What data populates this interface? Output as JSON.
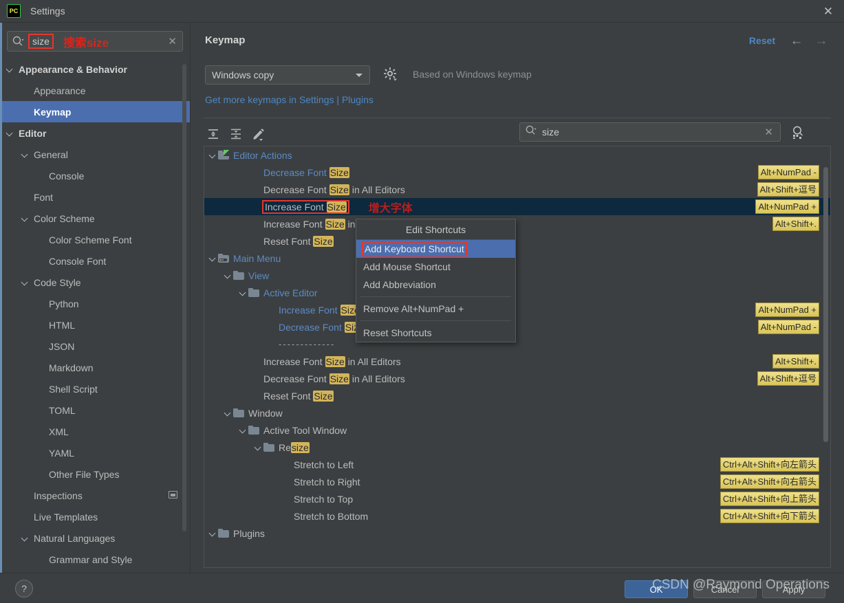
{
  "window": {
    "title": "Settings",
    "app_icon": "pycharm-icon",
    "close_icon": "close-icon"
  },
  "sidebar": {
    "search": {
      "value": "size",
      "annotation": "搜索size",
      "clear_icon": "clear-icon",
      "search_icon": "search-icon"
    },
    "items": [
      {
        "label": "Appearance & Behavior",
        "indent": 0,
        "chevron": true,
        "bold": true,
        "selected": false
      },
      {
        "label": "Appearance",
        "indent": 1,
        "chevron": false,
        "bold": false,
        "selected": false
      },
      {
        "label": "Keymap",
        "indent": 1,
        "chevron": false,
        "bold": true,
        "selected": true
      },
      {
        "label": "Editor",
        "indent": 0,
        "chevron": true,
        "bold": true,
        "selected": false
      },
      {
        "label": "General",
        "indent": 1,
        "chevron": true,
        "bold": false,
        "selected": false
      },
      {
        "label": "Console",
        "indent": 2,
        "chevron": false,
        "bold": false,
        "selected": false
      },
      {
        "label": "Font",
        "indent": 1,
        "chevron": false,
        "bold": false,
        "selected": false
      },
      {
        "label": "Color Scheme",
        "indent": 1,
        "chevron": true,
        "bold": false,
        "selected": false
      },
      {
        "label": "Color Scheme Font",
        "indent": 2,
        "chevron": false,
        "bold": false,
        "selected": false
      },
      {
        "label": "Console Font",
        "indent": 2,
        "chevron": false,
        "bold": false,
        "selected": false
      },
      {
        "label": "Code Style",
        "indent": 1,
        "chevron": true,
        "bold": false,
        "selected": false
      },
      {
        "label": "Python",
        "indent": 2,
        "chevron": false,
        "bold": false,
        "selected": false
      },
      {
        "label": "HTML",
        "indent": 2,
        "chevron": false,
        "bold": false,
        "selected": false
      },
      {
        "label": "JSON",
        "indent": 2,
        "chevron": false,
        "bold": false,
        "selected": false
      },
      {
        "label": "Markdown",
        "indent": 2,
        "chevron": false,
        "bold": false,
        "selected": false
      },
      {
        "label": "Shell Script",
        "indent": 2,
        "chevron": false,
        "bold": false,
        "selected": false
      },
      {
        "label": "TOML",
        "indent": 2,
        "chevron": false,
        "bold": false,
        "selected": false
      },
      {
        "label": "XML",
        "indent": 2,
        "chevron": false,
        "bold": false,
        "selected": false
      },
      {
        "label": "YAML",
        "indent": 2,
        "chevron": false,
        "bold": false,
        "selected": false
      },
      {
        "label": "Other File Types",
        "indent": 2,
        "chevron": false,
        "bold": false,
        "selected": false
      },
      {
        "label": "Inspections",
        "indent": 1,
        "chevron": false,
        "bold": false,
        "selected": false,
        "badge": true
      },
      {
        "label": "Live Templates",
        "indent": 1,
        "chevron": false,
        "bold": false,
        "selected": false
      },
      {
        "label": "Natural Languages",
        "indent": 1,
        "chevron": true,
        "bold": false,
        "selected": false
      },
      {
        "label": "Grammar and Style",
        "indent": 2,
        "chevron": false,
        "bold": false,
        "selected": false
      }
    ]
  },
  "panel": {
    "title": "Keymap",
    "reset_label": "Reset",
    "back_icon": "arrow-left-icon",
    "forward_icon": "arrow-right-icon",
    "keymap_select": {
      "value": "Windows copy",
      "options": [
        "Windows copy"
      ]
    },
    "gear_icon": "gear-icon",
    "based_on": "Based on Windows keymap",
    "get_more_link": "Get more keymaps in Settings | Plugins",
    "toolbar": {
      "expand_all_icon": "expand-all-icon",
      "collapse_all_icon": "collapse-all-icon",
      "edit_icon": "edit-pencil-icon"
    },
    "keymap_search": {
      "value": "size",
      "search_icon": "search-icon",
      "clear_icon": "clear-icon"
    },
    "find_shortcut_icon": "find-by-shortcut-icon"
  },
  "keymap_tree": [
    {
      "type": "group",
      "label": "Editor Actions",
      "indent": 0,
      "chevron": true,
      "icon": "editor-actions-folder-icon",
      "blue": true
    },
    {
      "type": "action",
      "pre": "Decrease Font ",
      "hl": "Size",
      "post": "",
      "indent": 3,
      "blue": true,
      "shortcut": "Alt+NumPad -"
    },
    {
      "type": "action",
      "pre": "Decrease Font ",
      "hl": "Size",
      "post": " in All Editors",
      "indent": 3,
      "blue": false,
      "shortcut": "Alt+Shift+逗号"
    },
    {
      "type": "action",
      "pre": "Increase Font ",
      "hl": "Size",
      "post": "",
      "indent": 3,
      "blue": false,
      "selected": true,
      "redbox": true,
      "annotation": "增大字体",
      "shortcut": "Alt+NumPad +"
    },
    {
      "type": "action",
      "pre": "Increase Font ",
      "hl": "Size",
      "post": " in All Editors",
      "indent": 3,
      "blue": false,
      "shortcut": "Alt+Shift+."
    },
    {
      "type": "action",
      "pre": "Reset Font ",
      "hl": "Size",
      "post": "",
      "indent": 3,
      "blue": false,
      "shortcut": ""
    },
    {
      "type": "group",
      "label": "Main Menu",
      "indent": 0,
      "chevron": true,
      "icon": "main-menu-folder-icon",
      "blue": true
    },
    {
      "type": "group",
      "label": "View",
      "indent": 1,
      "chevron": true,
      "icon": "folder-icon",
      "blue": true
    },
    {
      "type": "group",
      "label": "Active Editor",
      "indent": 2,
      "chevron": true,
      "icon": "folder-icon",
      "blue": true
    },
    {
      "type": "action",
      "pre": "Increase Font ",
      "hl": "Size",
      "post": "",
      "indent": 4,
      "blue": true,
      "shortcut": "Alt+NumPad +"
    },
    {
      "type": "action",
      "pre": "Decrease Font ",
      "hl": "Size",
      "post": "",
      "indent": 4,
      "blue": true,
      "shortcut": "Alt+NumPad -"
    },
    {
      "type": "separator",
      "label": "-------------",
      "indent": 4
    },
    {
      "type": "action",
      "pre": "Increase Font ",
      "hl": "Size",
      "post": " in All Editors",
      "indent": 3,
      "blue": false,
      "shortcut": "Alt+Shift+."
    },
    {
      "type": "action",
      "pre": "Decrease Font ",
      "hl": "Size",
      "post": " in All Editors",
      "indent": 3,
      "blue": false,
      "shortcut": "Alt+Shift+逗号"
    },
    {
      "type": "action",
      "pre": "Reset Font ",
      "hl": "Size",
      "post": "",
      "indent": 3,
      "blue": false,
      "shortcut": ""
    },
    {
      "type": "group",
      "label": "Window",
      "indent": 1,
      "chevron": true,
      "icon": "folder-icon",
      "blue": false
    },
    {
      "type": "group",
      "label": "Active Tool Window",
      "indent": 2,
      "chevron": true,
      "icon": "folder-icon",
      "blue": false
    },
    {
      "type": "group",
      "pre": "Re",
      "hl": "size",
      "post": "",
      "indent": 3,
      "chevron": true,
      "icon": "folder-icon",
      "blue": false
    },
    {
      "type": "action",
      "pre": "Stretch to Left",
      "hl": "",
      "post": "",
      "indent": 5,
      "blue": false,
      "shortcut": "Ctrl+Alt+Shift+向左箭头"
    },
    {
      "type": "action",
      "pre": "Stretch to Right",
      "hl": "",
      "post": "",
      "indent": 5,
      "blue": false,
      "shortcut": "Ctrl+Alt+Shift+向右箭头"
    },
    {
      "type": "action",
      "pre": "Stretch to Top",
      "hl": "",
      "post": "",
      "indent": 5,
      "blue": false,
      "shortcut": "Ctrl+Alt+Shift+向上箭头"
    },
    {
      "type": "action",
      "pre": "Stretch to Bottom",
      "hl": "",
      "post": "",
      "indent": 5,
      "blue": false,
      "shortcut": "Ctrl+Alt+Shift+向下箭头"
    },
    {
      "type": "group",
      "label": "Plugins",
      "indent": 0,
      "chevron": true,
      "icon": "folder-icon",
      "blue": false
    }
  ],
  "context_menu": {
    "title": "Edit Shortcuts",
    "items": [
      {
        "label": "Add Keyboard Shortcut",
        "highlighted": true,
        "redbox": true
      },
      {
        "label": "Add Mouse Shortcut",
        "highlighted": false
      },
      {
        "label": "Add Abbreviation",
        "highlighted": false
      },
      {
        "separator": true
      },
      {
        "label": "Remove Alt+NumPad +",
        "highlighted": false
      },
      {
        "separator": true
      },
      {
        "label": "Reset Shortcuts",
        "highlighted": false
      }
    ]
  },
  "bottom": {
    "help_icon": "help-icon",
    "ok_label": "OK",
    "cancel_label": "Cancel",
    "apply_label": "Apply"
  },
  "watermark": "CSDN @Raymond Operations",
  "colors": {
    "accent_blue": "#4b6eaf",
    "link_blue": "#4a88c7",
    "highlight_yellow": "#d3b55a",
    "annotation_red": "#e0221a",
    "selected_row": "#0d293e",
    "background": "#3c3f41"
  }
}
